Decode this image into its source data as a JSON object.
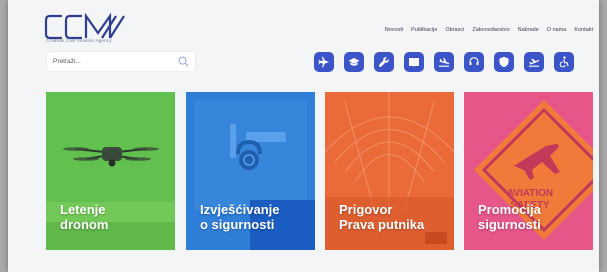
{
  "brand": {
    "tagline": "Croatian Civil Aviation Agency",
    "primary_color": "#3b54c8"
  },
  "nav": {
    "items": [
      "Novosti",
      "Publikacije",
      "Obrasci",
      "Zakonodavstvo",
      "Nabrade",
      "O nama",
      "Kontakt"
    ]
  },
  "search": {
    "placeholder": "Pretraži..."
  },
  "quick_icons": [
    {
      "icon": "plane-icon"
    },
    {
      "icon": "graduation-cap-icon"
    },
    {
      "icon": "wrench-icon"
    },
    {
      "icon": "book-icon"
    },
    {
      "icon": "plane-arrival-icon"
    },
    {
      "icon": "headset-icon"
    },
    {
      "icon": "shield-icon"
    },
    {
      "icon": "plane-departure-icon"
    },
    {
      "icon": "wheelchair-icon"
    }
  ],
  "tiles": [
    {
      "label": "Letenje\ndronom",
      "color": "#62c14e"
    },
    {
      "label": "Izvješćivanje\no sigurnosti",
      "color": "#2f7ed8"
    },
    {
      "label": "Prigovor\nPrava putnika",
      "color": "#ea6a3a"
    },
    {
      "label": "Promocija\nsigurnosti",
      "color": "#e65688"
    }
  ],
  "tile4_sign_text": "AVIATION\nSAFETY"
}
